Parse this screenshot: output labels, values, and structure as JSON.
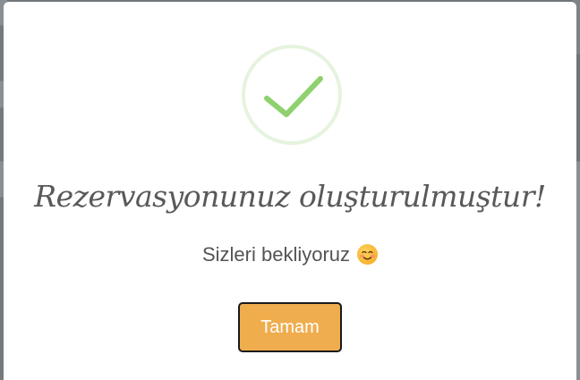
{
  "dialog": {
    "title": "Rezervasyonunuz oluşturulmuştur!",
    "message": "Sizleri bekliyoruz",
    "emoji_icon": "smiling-face-icon",
    "confirm_label": "Tamam"
  },
  "icons": {
    "success": "checkmark-icon"
  },
  "colors": {
    "checkmark": "#8fd16f",
    "checkmark_ring": "#e6f3df",
    "button_background": "#f0ad4e",
    "button_border": "#1a1a1a",
    "title_text": "#595959",
    "backdrop": "#70757a"
  }
}
